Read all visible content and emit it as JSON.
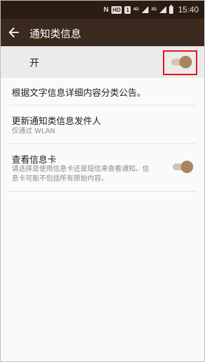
{
  "status_bar": {
    "nfc": "N",
    "hd": "HD",
    "sim": "1",
    "net1": "4G",
    "net2": "3G",
    "time": "15:40"
  },
  "app_bar": {
    "title": "通知类信息",
    "back_icon": "arrow-left-icon"
  },
  "master_switch": {
    "label": "开",
    "state": "on"
  },
  "items": [
    {
      "title": "根据文字信息详细内容分类公告。"
    },
    {
      "title": "更新通知类信息发件人",
      "subtitle": "仅通过 WLAN"
    },
    {
      "title": "查看信息卡",
      "subtitle_line1": "请选择是使用信息卡还是短信来查看通知。信",
      "subtitle_line2": "息卡可能不包括所有原始内容。",
      "state": "on"
    }
  ],
  "colors": {
    "status_bar": "#2a1c12",
    "app_bar": "#3b2a1e",
    "accent": "#a88460",
    "highlight": "#e3141b"
  }
}
